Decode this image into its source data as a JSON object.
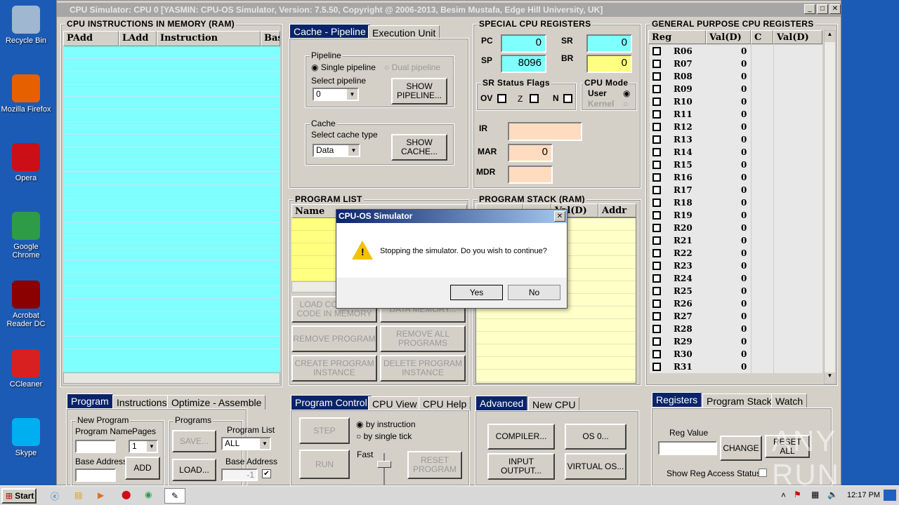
{
  "desktop": {
    "icons": [
      {
        "label": "Recycle Bin",
        "icon": "recycle-bin-icon",
        "color": "#9fb7d0"
      },
      {
        "label": "Mozilla Firefox",
        "icon": "firefox-icon",
        "color": "#e66000"
      },
      {
        "label": "Opera",
        "icon": "opera-icon",
        "color": "#cc0f16"
      },
      {
        "label": "Google Chrome",
        "icon": "chrome-icon",
        "color": "#2e9b47"
      },
      {
        "label": "Acrobat Reader DC",
        "icon": "acrobat-icon",
        "color": "#8b0000"
      },
      {
        "label": "CCleaner",
        "icon": "ccleaner-icon",
        "color": "#d82020"
      },
      {
        "label": "Skype",
        "icon": "skype-icon",
        "color": "#00aff0"
      }
    ]
  },
  "window": {
    "title": "CPU Simulator: CPU 0    [YASMIN: CPU-OS Simulator,  Version: 7.5.50,  Copyright @ 2006-2013, Besim Mustafa, Edge Hill University, UK]",
    "min": "_",
    "max": "□",
    "close": "✕"
  },
  "memory": {
    "title": "CPU INSTRUCTIONS IN MEMORY (RAM)",
    "columns": [
      "PAdd",
      "LAdd",
      "Instruction",
      "Bas"
    ]
  },
  "cache_tabs": {
    "tabs": [
      "Cache - Pipeline",
      "Execution Unit"
    ],
    "pipeline": {
      "label": "Pipeline",
      "single": "Single pipeline",
      "dual": "Dual pipeline",
      "select_label": "Select pipeline",
      "select_value": "0",
      "show": "SHOW PIPELINE..."
    },
    "cache": {
      "label": "Cache",
      "select_label": "Select cache type",
      "select_value": "Data",
      "show": "SHOW CACHE..."
    }
  },
  "special": {
    "title": "SPECIAL CPU REGISTERS",
    "PC": "0",
    "SP": "8096",
    "SR": "0",
    "BR": "0",
    "labels": {
      "pc": "PC",
      "sp": "SP",
      "sr": "SR",
      "br": "BR",
      "ir": "IR",
      "mar": "MAR",
      "mdr": "MDR"
    },
    "IR": "",
    "MAR": "0",
    "MDR": "",
    "flags": {
      "title": "SR Status Flags",
      "ov": "OV",
      "z": "Z",
      "n": "N"
    },
    "mode": {
      "title": "CPU Mode",
      "user": "User",
      "kernel": "Kernel"
    }
  },
  "general": {
    "title": "GENERAL PURPOSE CPU REGISTERS",
    "columns": [
      "Reg",
      "Val(D)",
      "C",
      "Val(D)"
    ],
    "rows": [
      [
        "R06",
        "0"
      ],
      [
        "R07",
        "0"
      ],
      [
        "R08",
        "0"
      ],
      [
        "R09",
        "0"
      ],
      [
        "R10",
        "0"
      ],
      [
        "R11",
        "0"
      ],
      [
        "R12",
        "0"
      ],
      [
        "R13",
        "0"
      ],
      [
        "R14",
        "0"
      ],
      [
        "R15",
        "0"
      ],
      [
        "R16",
        "0"
      ],
      [
        "R17",
        "0"
      ],
      [
        "R18",
        "0"
      ],
      [
        "R19",
        "0"
      ],
      [
        "R20",
        "0"
      ],
      [
        "R21",
        "0"
      ],
      [
        "R22",
        "0"
      ],
      [
        "R23",
        "0"
      ],
      [
        "R24",
        "0"
      ],
      [
        "R25",
        "0"
      ],
      [
        "R26",
        "0"
      ],
      [
        "R27",
        "0"
      ],
      [
        "R28",
        "0"
      ],
      [
        "R29",
        "0"
      ],
      [
        "R30",
        "0"
      ],
      [
        "R31",
        "0"
      ]
    ]
  },
  "program_list": {
    "title": "PROGRAM LIST",
    "columns": [
      "Name"
    ],
    "buttons": [
      "LOAD COMPILED CODE IN MEMORY",
      "DATA MEMORY...",
      "REMOVE PROGRAM",
      "REMOVE ALL PROGRAMS",
      "CREATE PROGRAM INSTANCE",
      "DELETE PROGRAM INSTANCE"
    ]
  },
  "program_stack": {
    "title": "PROGRAM STACK (RAM)",
    "columns": [
      "",
      "",
      "Val(D)",
      "Addr"
    ]
  },
  "dialog": {
    "title": "CPU-OS Simulator",
    "message": "Stopping the simulator. Do you wish to continue?",
    "yes": "Yes",
    "no": "No",
    "close": "✕"
  },
  "program_tabs": {
    "tabs": [
      "Program",
      "Instructions",
      "Optimize - Assemble"
    ],
    "new_program": {
      "label": "New Program",
      "name_label": "Program Name",
      "pages_label": "Pages",
      "pages_value": "1",
      "base_label": "Base Address",
      "add": "ADD"
    },
    "programs": {
      "label": "Programs",
      "save": "SAVE...",
      "list_label": "Program List",
      "list_value": "ALL",
      "load": "LOAD...",
      "base_label": "Base Address",
      "base_value": "-1"
    }
  },
  "control_tabs": {
    "tabs": [
      "Program Control",
      "CPU View",
      "CPU Help"
    ],
    "step": "STEP",
    "run": "RUN",
    "by_instruction": "by instruction",
    "by_tick": "by single tick",
    "fast": "Fast",
    "reset": "RESET PROGRAM"
  },
  "advanced_tabs": {
    "tabs": [
      "Advanced",
      "New CPU"
    ],
    "buttons": [
      "COMPILER...",
      "OS 0...",
      "INPUT OUTPUT...",
      "VIRTUAL OS..."
    ]
  },
  "register_tabs": {
    "tabs": [
      "Registers",
      "Program Stack",
      "Watch"
    ],
    "reg_value_label": "Reg Value",
    "change": "CHANGE",
    "reset_all": "RESET ALL",
    "show_access": "Show Reg Access Status"
  },
  "watermark": "ANY RUN",
  "taskbar": {
    "start": "Start",
    "time": "12:17 PM"
  }
}
